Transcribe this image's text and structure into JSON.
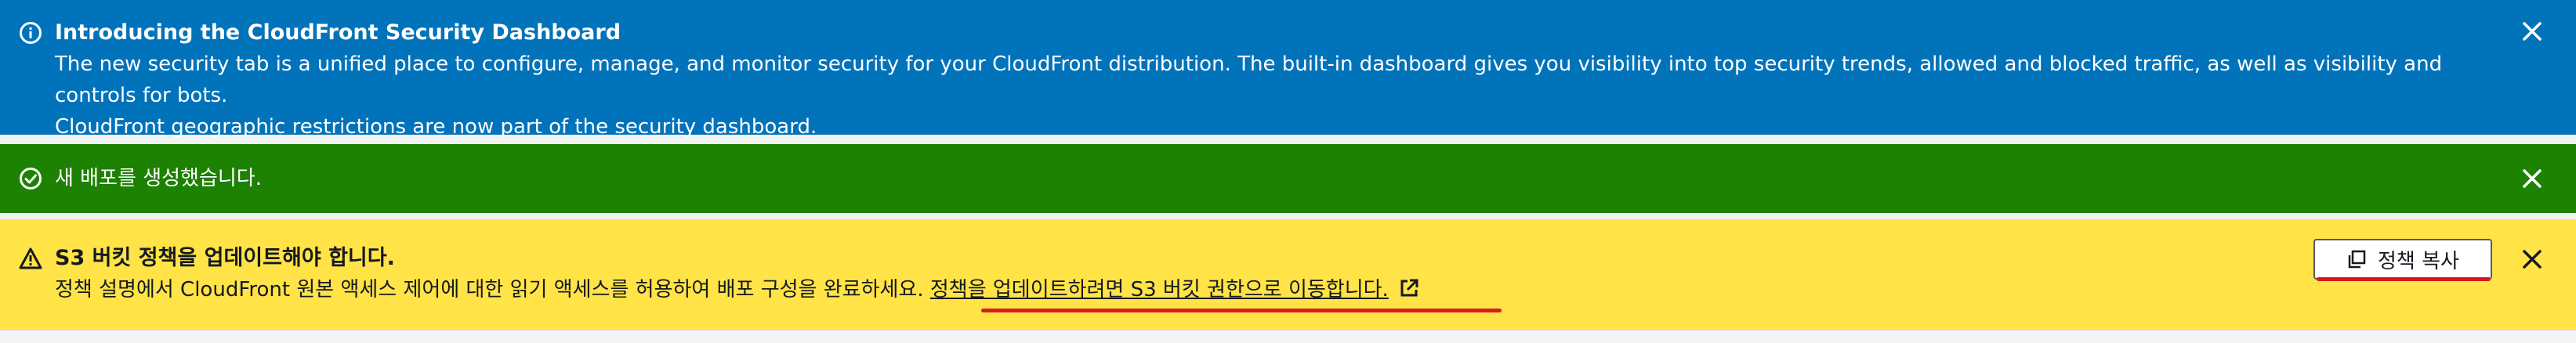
{
  "colors": {
    "info": "#0073bb",
    "success": "#1d8102",
    "warning": "#ffe347",
    "annotation": "#d61c1c"
  },
  "info_flash": {
    "icon": "info-icon",
    "title": "Introducing the CloudFront Security Dashboard",
    "line1": "The new security tab is a unified place to configure, manage, and monitor security for your CloudFront distribution. The built-in dashboard gives you visibility into top security trends, allowed and blocked traffic, as well as visibility and controls for bots.",
    "line2": "CloudFront geographic restrictions are now part of the security dashboard.",
    "close_icon": "close-icon"
  },
  "success_flash": {
    "icon": "check-circle-icon",
    "message": "새 배포를 생성했습니다.",
    "close_icon": "close-icon"
  },
  "warning_flash": {
    "icon": "warning-icon",
    "title": "S3 버킷 정책을 업데이트해야 합니다.",
    "body": "정책 설명에서 CloudFront 원본 액세스 제어에 대한 읽기 액세스를 허용하여 배포 구성을 완료하세요.",
    "link_text": "정책을 업데이트하려면 S3 버킷 권한으로 이동합니다.",
    "link_icon": "external-link-icon",
    "copy_button_label": "정책 복사",
    "copy_icon": "copy-icon",
    "close_icon": "close-icon"
  }
}
